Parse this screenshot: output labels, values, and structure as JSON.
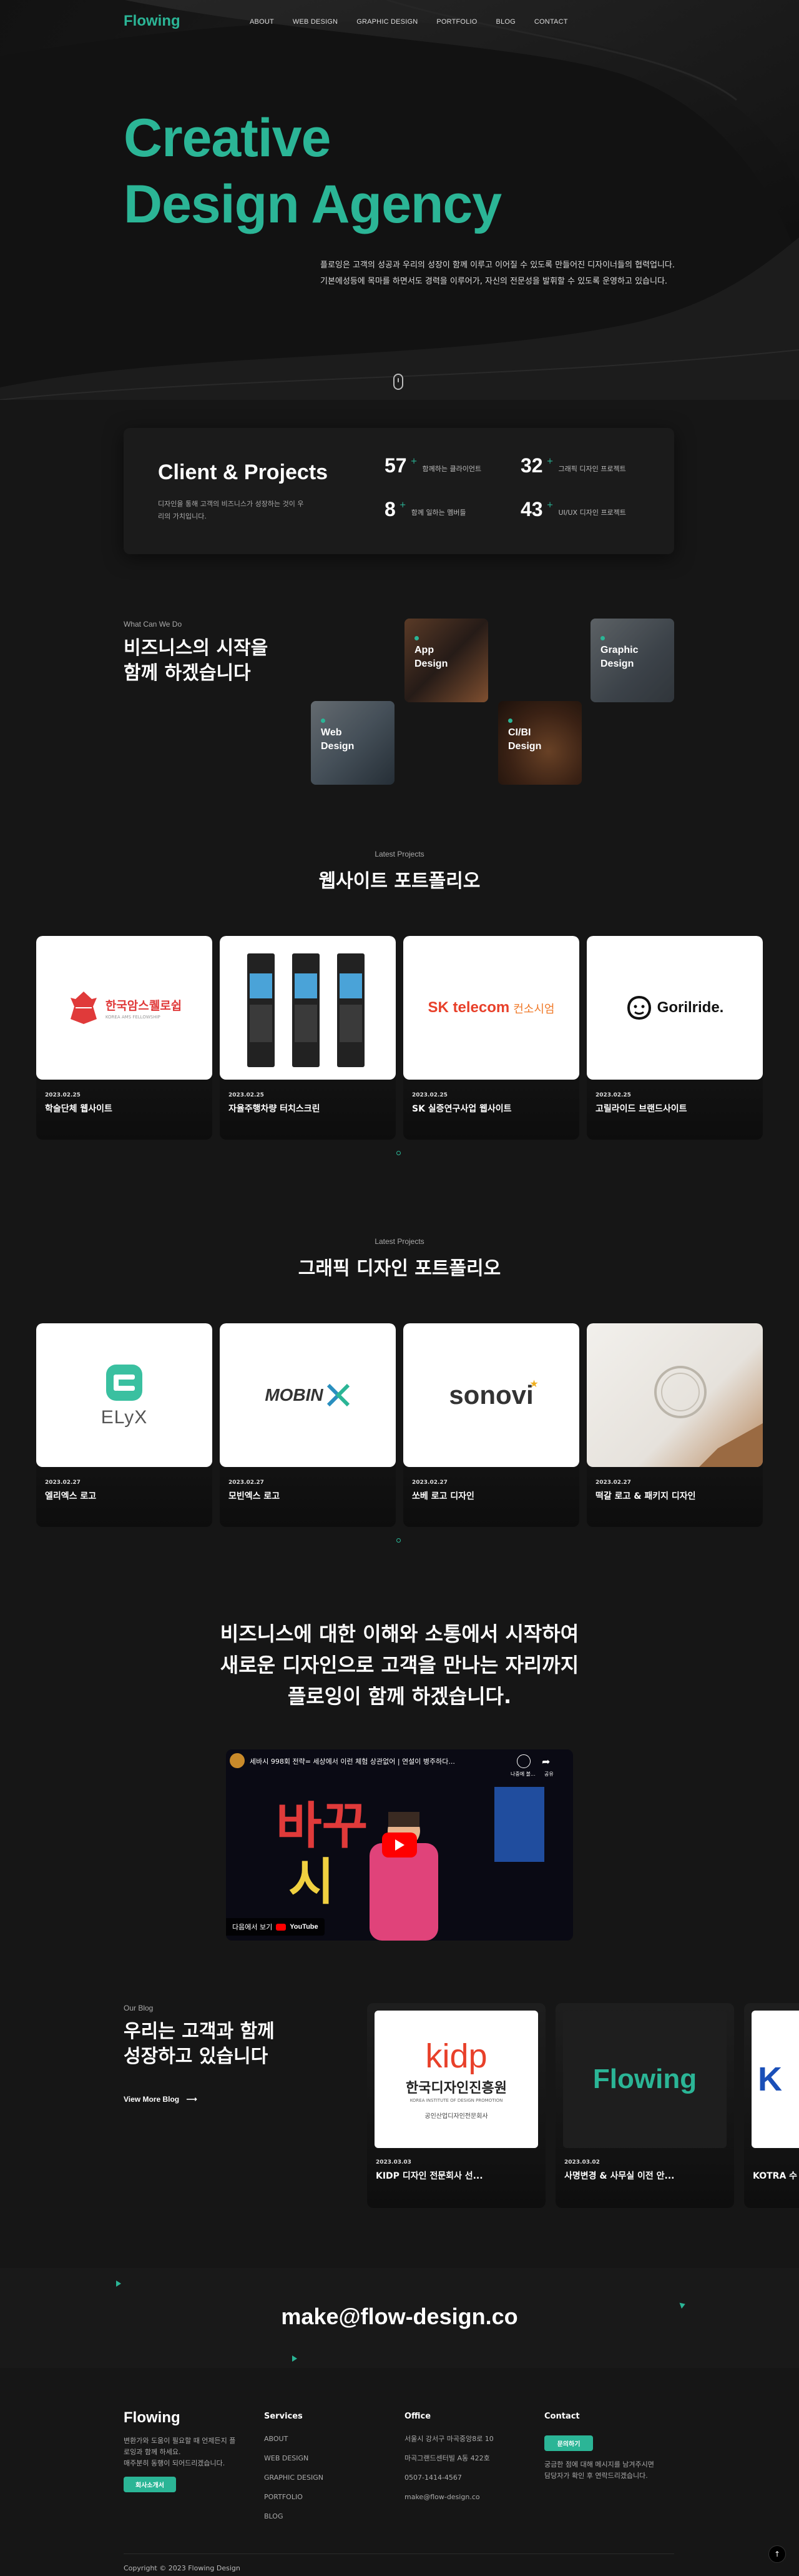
{
  "header": {
    "logo": "Flowing",
    "nav": [
      "ABOUT",
      "WEB DESIGN",
      "GRAPHIC DESIGN",
      "PORTFOLIO",
      "BLOG",
      "CONTACT"
    ]
  },
  "hero": {
    "title_line1": "Creative",
    "title_line2": "Design Agency",
    "desc_line1": "플로잉은 고객의 성공과 우리의 성장이 함께 이루고 이어질 수 있도록 만들어진 디자이너들의 협력업니다.",
    "desc_line2": "기본에성등에 목마를 하면서도 경력을 이루어가, 자신의 전문성을 발휘할 수 있도록 운영하고 있습니다."
  },
  "stats": {
    "title": "Client & Projects",
    "desc": "디자인을 통해 고객의 비즈니스가 성장하는 것이 우리의 가치입니다.",
    "items": [
      {
        "num": "57",
        "plus": "+",
        "label": "함께하는 클라이언트"
      },
      {
        "num": "32",
        "plus": "+",
        "label": "그래픽 디자인 프로젝트"
      },
      {
        "num": "8",
        "plus": "+",
        "label": "함께 일하는 멤버들"
      },
      {
        "num": "43",
        "plus": "+",
        "label": "UI/UX 디자인 프로젝트"
      }
    ]
  },
  "services": {
    "eyebrow": "What Can We Do",
    "title_line1": "비즈니스의 시작을",
    "title_line2": "함께 하겠습니다",
    "tiles": [
      {
        "line1": "App",
        "line2": "Design"
      },
      {
        "line1": "Graphic",
        "line2": "Design"
      },
      {
        "line1": "Web",
        "line2": "Design"
      },
      {
        "line1": "CI/BI",
        "line2": "Design"
      }
    ]
  },
  "web_portfolio": {
    "eyebrow": "Latest Projects",
    "title": "웹사이트 포트폴리오",
    "cards": [
      {
        "date": "2023.02.25",
        "name": "학술단체 웹사이트",
        "logo": "한국암스퀠로쉽",
        "logo_sub": "KOREA AMS FELLOWSHIP"
      },
      {
        "date": "2023.02.25",
        "name": "자율주행차량 터치스크린",
        "logo": "",
        "logo_sub": ""
      },
      {
        "date": "2023.02.25",
        "name": "SK 실증연구사업 웹사이트",
        "logo": "SK telecom",
        "logo_sub": "컨소시엄"
      },
      {
        "date": "2023.02.25",
        "name": "고릴라이드 브랜드사이트",
        "logo": "Gorilride.",
        "logo_sub": ""
      }
    ]
  },
  "graphic_portfolio": {
    "eyebrow": "Latest Projects",
    "title": "그래픽 디자인 포트폴리오",
    "cards": [
      {
        "date": "2023.02.27",
        "name": "엘리엑스 로고",
        "logo": "ELyX"
      },
      {
        "date": "2023.02.27",
        "name": "모빈엑스 로고",
        "logo": "MOBIN"
      },
      {
        "date": "2023.02.27",
        "name": "쏘베 로고 디자인",
        "logo": "sonovi"
      },
      {
        "date": "2023.02.27",
        "name": "떡갈 로고 & 패키지 디자인",
        "logo": ""
      }
    ]
  },
  "statement": {
    "line1": "비즈니스에 대한 이해와 소통에서 시작하여",
    "line2": "새로운 디자인으로 고객을 만나는 자리까지",
    "line3": "플로잉이 함께 하겠습니다."
  },
  "video": {
    "title": "세바시 998회 전략= 세상에서 이런 체험 상관없어 | 연설이 병주하다...",
    "watch_on": "다음에서 보기",
    "youtube": "YouTube",
    "later": "나중에 볼...",
    "share": "공유"
  },
  "blog": {
    "eyebrow": "Our Blog",
    "title_line1": "우리는 고객과 함께",
    "title_line2": "성장하고 있습니다",
    "view_more": "View More Blog",
    "cards": [
      {
        "date": "2023.03.03",
        "name": "KIDP 디자인 전문회사 선...",
        "logo": "kidp",
        "sub1": "한국디자인진흥원",
        "sub2": "KOREA INSTITUTE OF DESIGN PROMOTION",
        "sub3": "공인산업디자인전문회사"
      },
      {
        "date": "2023.03.02",
        "name": "사명변경 & 사무실 이전 안...",
        "logo": "Flowing"
      },
      {
        "date": "",
        "name": "KOTRA 수",
        "logo": "K"
      }
    ]
  },
  "email": "make@flow-design.co",
  "footer": {
    "logo": "Flowing",
    "about": "변환가와 도움이 필요할 때 언제든지 플로잉과 함께 하세요.",
    "about2": "매주분히 동행이 되어드리겠습니다.",
    "about_btn": "회사소개서",
    "services_h": "Services",
    "services": [
      "ABOUT",
      "WEB DESIGN",
      "GRAPHIC DESIGN",
      "PORTFOLIO",
      "BLOG"
    ],
    "office_h": "Office",
    "office": [
      "서울시 강서구 마곡중앙8로 10",
      "마곡그랜드센터빌 A동 422호",
      "0507-1414-4567",
      "make@flow-design.co"
    ],
    "contact_h": "Contact",
    "contact_btn": "문의하기",
    "contact_desc1": "궁금한 점에 대해 메시지를 남겨주시면",
    "contact_desc2": "담당자가 확인 후 연락드리겠습니다.",
    "copyright": "Copyright © 2023 Flowing Design"
  },
  "colors": {
    "accent": "#2bb596",
    "bg": "#161616"
  }
}
